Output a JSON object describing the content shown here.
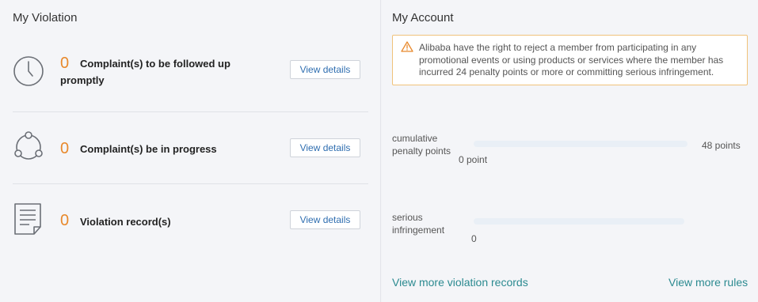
{
  "violation": {
    "title": "My Violation",
    "items": [
      {
        "count": "0",
        "label": "Complaint(s) to be followed up promptly",
        "button": "View details",
        "icon": "clock-icon"
      },
      {
        "count": "0",
        "label": "Complaint(s) be in progress",
        "button": "View details",
        "icon": "cycle-icon"
      },
      {
        "count": "0",
        "label": "Violation record(s)",
        "button": "View details",
        "icon": "document-icon"
      }
    ]
  },
  "account": {
    "title": "My Account",
    "notice": "Alibaba have the right to reject a member from participating in any promotional events or using products or services where the member has incurred 24 penalty points or more or committing serious infringement.",
    "notice_icon": "warning-icon",
    "penalty": {
      "label": "cumulative penalty points",
      "min_label": "0 point",
      "max_label": "48 points",
      "value": 0
    },
    "serious": {
      "label": "serious infringement",
      "min_label": "0",
      "value": 0
    },
    "links": {
      "records": "View more violation records",
      "rules": "View more rules"
    }
  },
  "colors": {
    "count": "#e8892c",
    "link": "#2b8a90",
    "button_text": "#2f6eb0",
    "notice_border": "#f0c27a",
    "bar": "#e9eff6"
  }
}
